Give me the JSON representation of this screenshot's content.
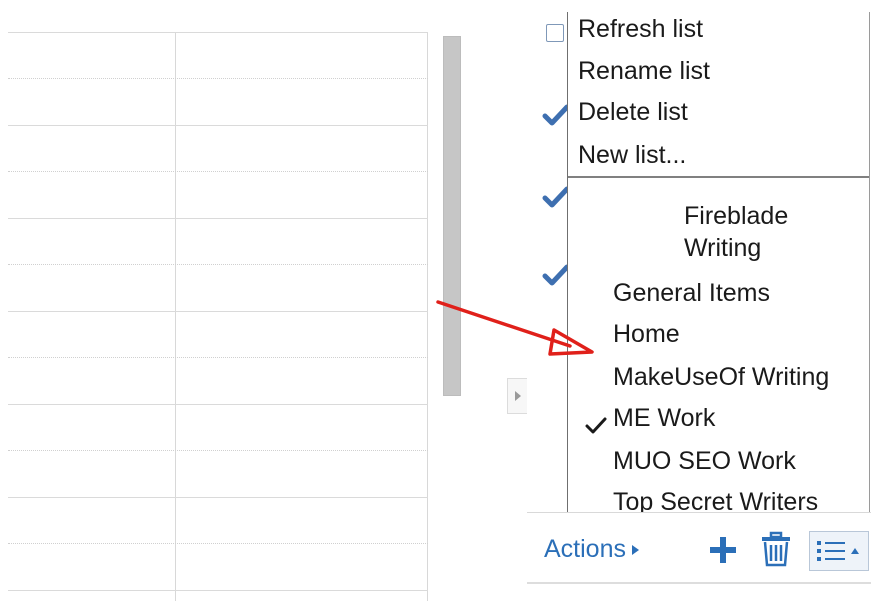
{
  "menu": {
    "actions": [
      {
        "label": "Refresh list"
      },
      {
        "label": "Rename list"
      },
      {
        "label": "Delete list"
      },
      {
        "label": "New list..."
      }
    ],
    "lists": [
      {
        "label": "Fireblade Writing",
        "checked": false
      },
      {
        "label": "General Items",
        "checked": false
      },
      {
        "label": "Home",
        "checked": false
      },
      {
        "label": "MakeUseOf Writing",
        "checked": false
      },
      {
        "label": "ME Work",
        "checked": true
      },
      {
        "label": "MUO SEO Work",
        "checked": false
      },
      {
        "label": "Top Secret Writers",
        "checked": false
      }
    ]
  },
  "toolbar": {
    "actions_label": "Actions",
    "add_icon": "plus-icon",
    "delete_icon": "trash-icon",
    "list_icon": "list-menu-icon"
  },
  "colors": {
    "link": "#2b6fb8",
    "annotation_arrow": "#e0201a",
    "check_blue": "#3e6fb0"
  }
}
